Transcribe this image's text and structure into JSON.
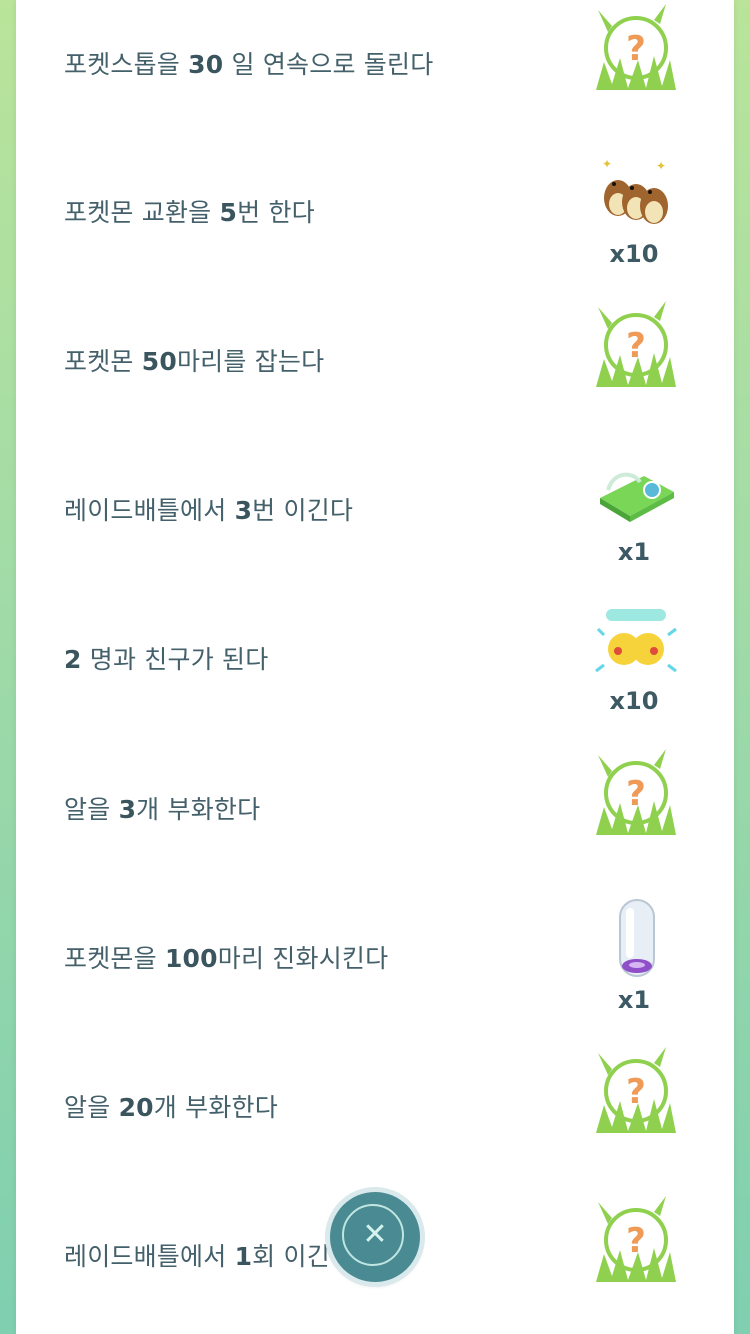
{
  "tasks": [
    {
      "pre": "포켓스톱을 ",
      "num": "30",
      "post": " 일 연속으로 돌린다",
      "reward": "mystery-encounter-icon",
      "qty": ""
    },
    {
      "pre": "포켓몬 교환을 ",
      "num": "5",
      "post": "번 한다",
      "reward": "pidgey-icon",
      "qty": "x10"
    },
    {
      "pre": "포켓몬 ",
      "num": "50",
      "post": "마리를 잡는다",
      "reward": "mystery-encounter-icon",
      "qty": ""
    },
    {
      "pre": "레이드배틀에서 ",
      "num": "3",
      "post": "번 이긴다",
      "reward": "raid-pass-icon",
      "qty": "x1"
    },
    {
      "pre": "",
      "num": "2",
      "post": " 명과 친구가 된다",
      "reward": "pikachu-sticker-icon",
      "qty": "x10"
    },
    {
      "pre": "알을 ",
      "num": "3",
      "post": "개 부화한다",
      "reward": "mystery-encounter-icon",
      "qty": ""
    },
    {
      "pre": "포켓몬을 ",
      "num": "100",
      "post": "마리 진화시킨다",
      "reward": "incubator-icon",
      "qty": "x1"
    },
    {
      "pre": "알을 ",
      "num": "20",
      "post": "개 부화한다",
      "reward": "mystery-encounter-icon",
      "qty": ""
    },
    {
      "pre": "레이드배틀에서 ",
      "num": "1",
      "post": "회 이긴다",
      "reward": "mystery-encounter-icon",
      "qty": ""
    }
  ],
  "close_button": {
    "icon": "close-icon",
    "glyph": "✕"
  },
  "colors": {
    "accent": "#4a8a92",
    "text": "#44606a",
    "grass": "#8fd14f",
    "question": "#ef9a57"
  }
}
